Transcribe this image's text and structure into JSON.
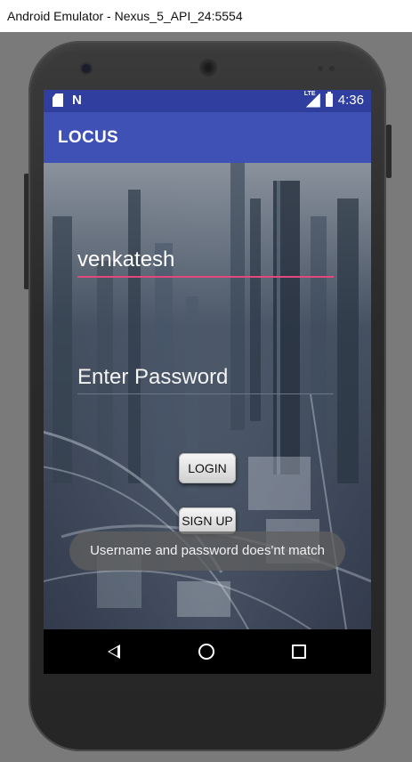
{
  "window": {
    "title": "Android Emulator - Nexus_5_API_24:5554"
  },
  "statusbar": {
    "network": "LTE",
    "time": "4:36"
  },
  "appbar": {
    "title": "LOCUS"
  },
  "form": {
    "username_value": "venkatesh",
    "password_placeholder": "Enter Password",
    "login_label": "LOGIN",
    "signup_label": "SIGN UP"
  },
  "toast": {
    "message": "Username and password does'nt match"
  },
  "colors": {
    "statusbar": "#303f9f",
    "appbar": "#3f51b5",
    "input_underline_active": "#e2477d"
  }
}
